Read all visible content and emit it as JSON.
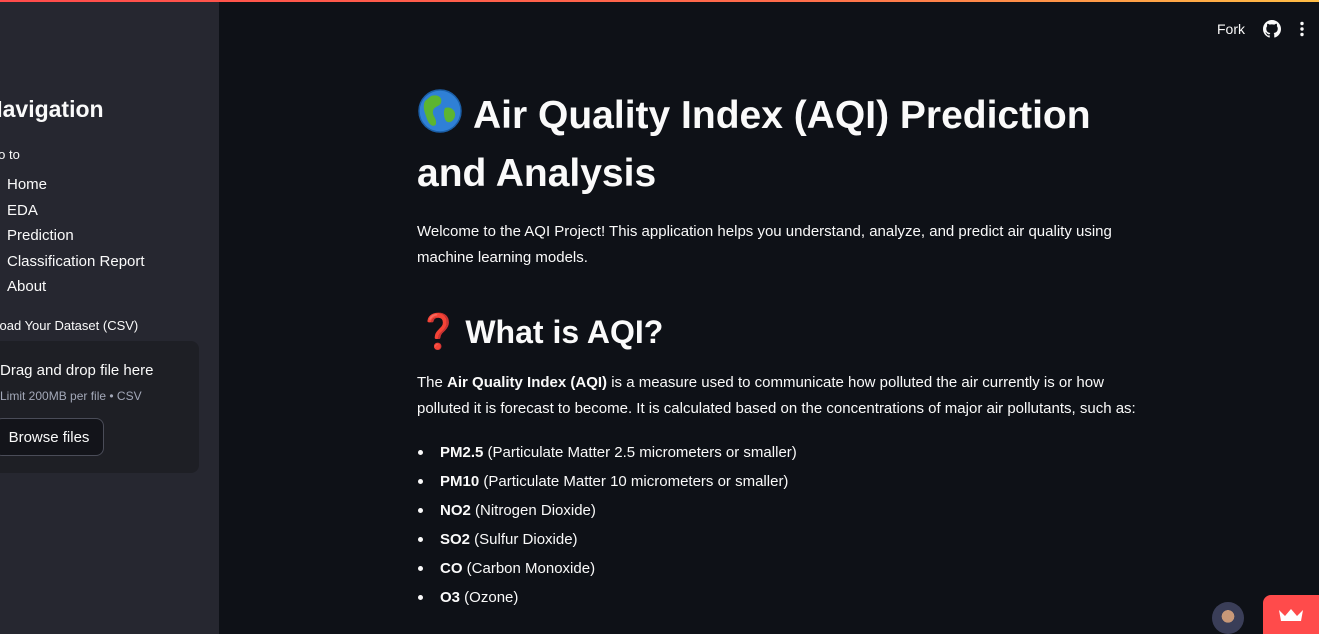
{
  "header": {
    "fork_label": "Fork",
    "github_icon": "github-icon",
    "menu_icon": "kebab-menu-icon"
  },
  "sidebar": {
    "title": "Navigation",
    "radio_label": "Go to",
    "items": [
      {
        "label": "Home"
      },
      {
        "label": "EDA"
      },
      {
        "label": "Prediction"
      },
      {
        "label": "Classification Report"
      },
      {
        "label": "About"
      }
    ],
    "upload": {
      "label": "Upload Your Dataset (CSV)",
      "drop_text": "Drag and drop file here",
      "limit_text": "Limit 200MB per file • CSV",
      "browse_label": "Browse files"
    }
  },
  "main": {
    "title_emoji": "globe-icon",
    "title": "Air Quality Index (AQI) Prediction and Analysis",
    "welcome": "Welcome to the AQI Project! This application helps you understand, analyze, and predict air quality using machine learning models.",
    "section_title": "What is AQI?",
    "section_icon": "question-mark-icon",
    "desc_prefix": "The ",
    "desc_bold": "Air Quality Index (AQI)",
    "desc_rest": " is a measure used to communicate how polluted the air currently is or how polluted it is forecast to become. It is calculated based on the concentrations of major air pollutants, such as:",
    "pollutants": [
      {
        "name": "PM2.5",
        "desc": " (Particulate Matter 2.5 micrometers or smaller)"
      },
      {
        "name": "PM10",
        "desc": " (Particulate Matter 10 micrometers or smaller)"
      },
      {
        "name": "NO2",
        "desc": " (Nitrogen Dioxide)"
      },
      {
        "name": "SO2",
        "desc": " (Sulfur Dioxide)"
      },
      {
        "name": "CO",
        "desc": " (Carbon Monoxide)"
      },
      {
        "name": "O3",
        "desc": " (Ozone)"
      }
    ]
  },
  "colors": {
    "background": "#0e1117",
    "sidebar": "#262730",
    "accent": "#ff4b4b"
  }
}
